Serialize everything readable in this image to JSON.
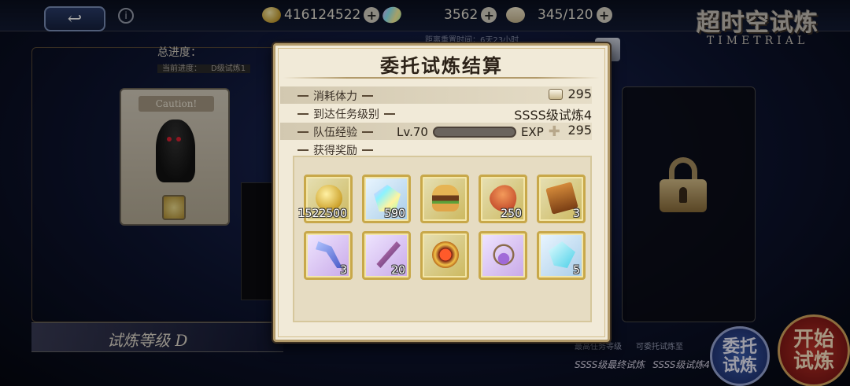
{
  "topbar": {
    "coins": "416124522",
    "gems": "3562",
    "stamina": "345/120",
    "logo_cn": "超时空试炼",
    "logo_en": "TIMETRIAL",
    "reset_time": "距离重置时间：6天23小时"
  },
  "background": {
    "progress_label": "总进度：",
    "current_progress_label": "当前进度：",
    "current_progress_value": "D级试炼1",
    "caution": "Caution!",
    "trial_level": "试炼等级 D",
    "highest_level_label": "最高任务等级",
    "entrust_available_label": "可委托试炼至",
    "highest_level_value": "SSSS级最终试炼",
    "entrust_available_value": "SSSS级试炼4",
    "entrust_button": "委托试炼",
    "start_button": "开始试炼"
  },
  "modal": {
    "title": "委托试炼结算",
    "rows": {
      "stamina_label": "消耗体力",
      "stamina_value": "295",
      "reached_label": "到达任务级别",
      "reached_value": "SSSS级试炼4",
      "exp_label": "队伍经验",
      "exp_level": "Lv.70",
      "exp_tag": "EXP",
      "exp_value": "295",
      "rewards_label": "获得奖励"
    },
    "rewards": [
      {
        "icon": "gold-coin-icon",
        "qty": "1522500"
      },
      {
        "icon": "rainbow-gem-icon",
        "qty": "590"
      },
      {
        "icon": "burger-icon",
        "qty": ""
      },
      {
        "icon": "orange-seed-icon",
        "qty": "250"
      },
      {
        "icon": "ticket-card-icon",
        "qty": "3"
      },
      {
        "icon": "blue-hammer-icon",
        "qty": "3"
      },
      {
        "icon": "magic-staff-icon",
        "qty": "20"
      },
      {
        "icon": "sun-emblem-icon",
        "qty": ""
      },
      {
        "icon": "amulet-icon",
        "qty": ""
      },
      {
        "icon": "blue-crystal-icon",
        "qty": "5"
      }
    ]
  }
}
